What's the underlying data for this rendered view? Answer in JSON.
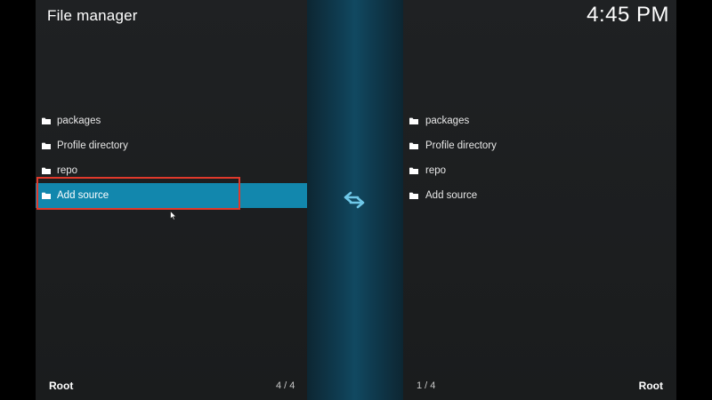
{
  "header": {
    "title": "File manager",
    "clock": "4:45 PM"
  },
  "left_pane": {
    "items": [
      {
        "label": "packages",
        "icon": "folder-icon"
      },
      {
        "label": "Profile directory",
        "icon": "folder-icon"
      },
      {
        "label": "repo",
        "icon": "folder-icon"
      },
      {
        "label": "Add source",
        "icon": "folder-icon",
        "selected": true
      }
    ],
    "footer_label": "Root",
    "footer_count": "4 / 4"
  },
  "right_pane": {
    "items": [
      {
        "label": "packages",
        "icon": "folder-icon"
      },
      {
        "label": "Profile directory",
        "icon": "folder-icon"
      },
      {
        "label": "repo",
        "icon": "folder-icon"
      },
      {
        "label": "Add source",
        "icon": "folder-icon"
      }
    ],
    "footer_label": "Root",
    "footer_count": "1 / 4"
  },
  "center": {
    "icon": "swap-arrows-icon"
  },
  "colors": {
    "accent": "#1287ad",
    "highlight_box": "#e0392b",
    "background": "#1c1e1f"
  }
}
